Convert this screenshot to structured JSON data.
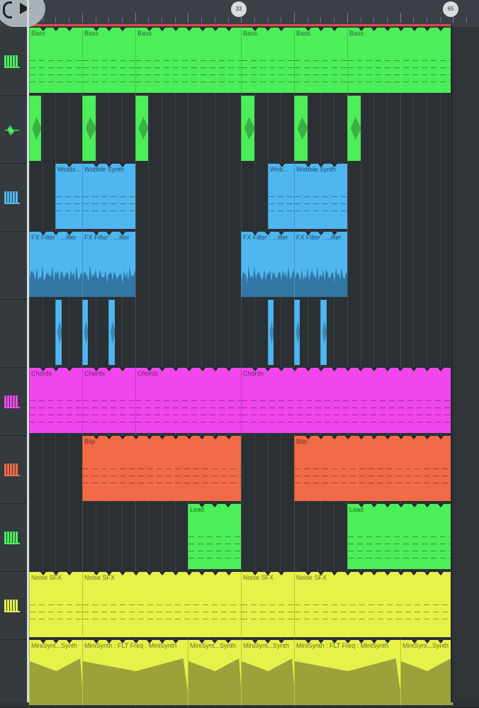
{
  "timeline": {
    "markers": [
      {
        "label": "33"
      },
      {
        "label": "65"
      }
    ]
  },
  "colors": {
    "green": "#4cee5a",
    "blue": "#4fb6f0",
    "magenta": "#f046ec",
    "orange": "#f26a46",
    "lime": "#e6f24a",
    "olive": "#9ba23a",
    "wave_blue": "#3276a3",
    "loop_red": "#e0484f"
  },
  "tracks": [
    {
      "icon": "piano-icon",
      "color": "#4cee5a",
      "clips": [
        {
          "label": "Bass"
        },
        {
          "label": "Bass"
        },
        {
          "label": "Bass"
        },
        {
          "label": "Bass"
        },
        {
          "label": "Bass"
        },
        {
          "label": "Bass"
        }
      ]
    },
    {
      "icon": "waveform-icon",
      "color": "#4cee5a",
      "clips": [
        {
          "label": ""
        },
        {
          "label": ""
        },
        {
          "label": ""
        },
        {
          "label": ""
        },
        {
          "label": ""
        },
        {
          "label": ""
        }
      ]
    },
    {
      "icon": "piano-icon",
      "color": "#4fb6f0",
      "clips": [
        {
          "label": "Wobbl..."
        },
        {
          "label": "Wobble Synth"
        },
        {
          "label": "Wobbl..."
        },
        {
          "label": "Wobble Synth"
        }
      ]
    },
    {
      "icon": "none",
      "color": "#4fb6f0",
      "clips": [
        {
          "label": "FX Filter : ...ilter"
        },
        {
          "label": "FX Filter : ...ilter"
        },
        {
          "label": "FX Filter : ...ilter"
        },
        {
          "label": "FX Filter : ...ilter"
        }
      ]
    },
    {
      "icon": "none",
      "color": "#4fb6f0",
      "clips": [
        {
          "label": ""
        },
        {
          "label": ""
        },
        {
          "label": ""
        },
        {
          "label": ""
        },
        {
          "label": ""
        },
        {
          "label": ""
        }
      ]
    },
    {
      "icon": "piano-icon",
      "color": "#f046ec",
      "clips": [
        {
          "label": "Chords"
        },
        {
          "label": "Chords"
        },
        {
          "label": "Chords"
        },
        {
          "label": "Chords"
        }
      ]
    },
    {
      "icon": "piano-icon",
      "color": "#f26a46",
      "clips": [
        {
          "label": "Blip"
        },
        {
          "label": "Blip"
        }
      ]
    },
    {
      "icon": "piano-icon",
      "color": "#4cee5a",
      "clips": [
        {
          "label": "Lead"
        },
        {
          "label": "Lead"
        }
      ]
    },
    {
      "icon": "piano-icon",
      "color": "#e6f24a",
      "clips": [
        {
          "label": "Noise SFX"
        },
        {
          "label": "Noise SFX"
        },
        {
          "label": "Noise SFX"
        },
        {
          "label": "Noise SFX"
        }
      ]
    },
    {
      "icon": "none",
      "color": "#e6f24a",
      "clips": [
        {
          "label": "MiniSynt...Synth"
        },
        {
          "label": "MiniSynth : FLT Freq : MiniSynth"
        },
        {
          "label": "MiniSynt...Synth"
        },
        {
          "label": "MiniSynt...Synth"
        },
        {
          "label": "MiniSynth : FLT Freq : MiniSynth"
        },
        {
          "label": "MiniSynt...Synth"
        }
      ]
    }
  ]
}
